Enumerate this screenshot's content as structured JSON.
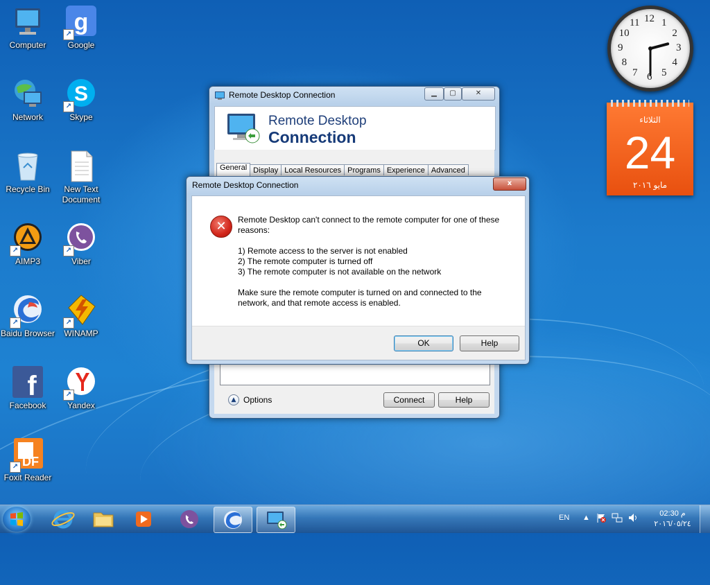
{
  "desktop": {
    "icons": [
      {
        "label": "Computer"
      },
      {
        "label": "Google"
      },
      {
        "label": "Network"
      },
      {
        "label": "Skype"
      },
      {
        "label": "Recycle Bin"
      },
      {
        "label": "New Text Document"
      },
      {
        "label": "AIMP3"
      },
      {
        "label": "Viber"
      },
      {
        "label": "Baidu Browser"
      },
      {
        "label": "WINAMP"
      },
      {
        "label": "Facebook"
      },
      {
        "label": "Yandex"
      },
      {
        "label": "Foxit Reader"
      }
    ]
  },
  "clock": {
    "numerals": [
      "12",
      "1",
      "2",
      "3",
      "4",
      "5",
      "6",
      "7",
      "8",
      "9",
      "10",
      "11"
    ],
    "time_hours": 2,
    "time_minutes": 30
  },
  "calendar": {
    "weekday": "الثلاثاء",
    "day": "24",
    "month_year": "مايو ٢٠١٦"
  },
  "rdc_window": {
    "title": "Remote Desktop Connection",
    "banner_line1": "Remote Desktop",
    "banner_line2": "Connection",
    "tabs": [
      "General",
      "Display",
      "Local Resources",
      "Programs",
      "Experience",
      "Advanced"
    ],
    "options_label": "Options",
    "connect_label": "Connect",
    "help_label": "Help"
  },
  "error_dialog": {
    "title": "Remote Desktop Connection",
    "intro": "Remote Desktop can't connect to the remote computer for one of these reasons:",
    "reasons": [
      "1) Remote access to the server is not enabled",
      "2) The remote computer is turned off",
      "3) The remote computer is not available on the network"
    ],
    "advice": "Make sure the remote computer is turned on and connected to the network, and that remote access is enabled.",
    "ok_label": "OK",
    "help_label": "Help",
    "close_glyph": "x"
  },
  "taskbar": {
    "language": "EN",
    "time": "02:30 م",
    "date": "٢٠١٦/٠٥/٢٤"
  },
  "colors": {
    "calendar_orange": "#e8500f",
    "error_red": "#d2261b",
    "title_blue": "#163a78"
  }
}
